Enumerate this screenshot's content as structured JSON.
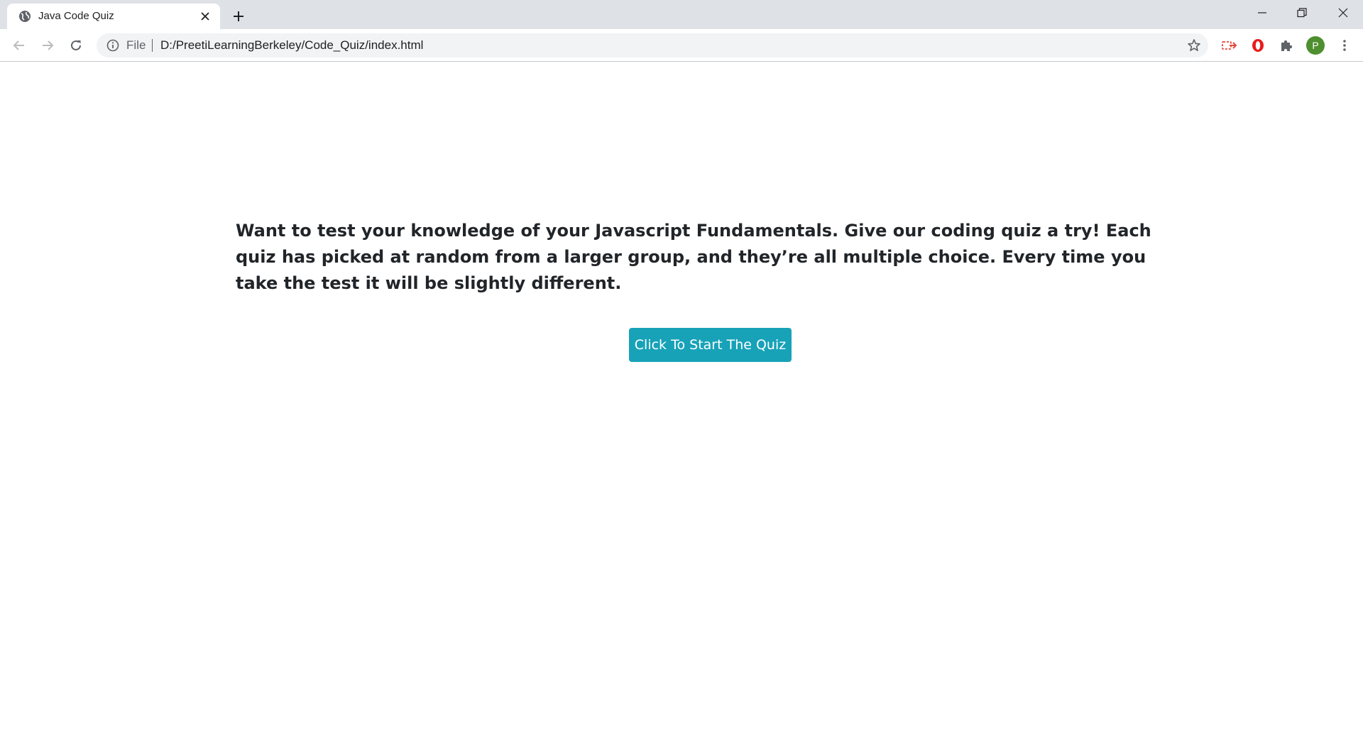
{
  "browser": {
    "tab_title": "Java Code Quiz",
    "address_scheme": "File",
    "address_url": "D:/PreetiLearningBerkeley/Code_Quiz/index.html",
    "profile_initial": "P",
    "icons": {
      "tab_favicon": "globe-icon",
      "tab_close": "close-icon",
      "new_tab": "plus-icon",
      "minimize": "minimize-icon",
      "restore": "restore-icon",
      "close_window": "close-icon",
      "back": "arrow-left-icon",
      "forward": "arrow-right-icon",
      "reload": "reload-icon",
      "site_info": "info-icon",
      "bookmark": "star-icon",
      "extension_1": "cast-arrow-icon",
      "extension_2": "opera-icon",
      "extensions": "puzzle-icon",
      "menu": "kebab-menu-icon"
    },
    "colors": {
      "accent_profile": "#4e8f2f",
      "tabstrip": "#dee1e6"
    }
  },
  "page": {
    "intro_text": "Want to test your knowledge of your Javascript Fundamentals. Give our coding quiz a try! Each quiz has picked at random from a larger group, and they’re all multiple choice. Every time you take the test it will be slightly different.",
    "start_button_label": "Click To Start The Quiz",
    "colors": {
      "button": "#17a2b8",
      "text": "#212529"
    }
  }
}
